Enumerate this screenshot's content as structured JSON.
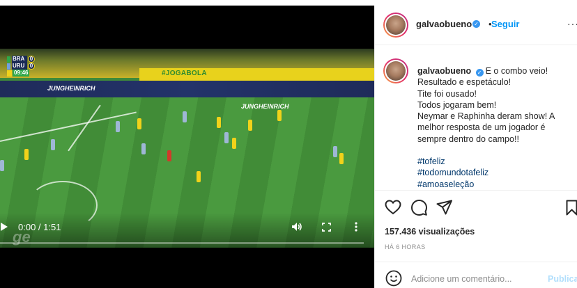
{
  "video": {
    "scoreboard": {
      "home_team": "BRA",
      "home_score": "0",
      "away_team": "URU",
      "away_score": "0",
      "clock": "09:46"
    },
    "banner_text": "#JOGABOLA",
    "ad_text": "JUNGHEINRICH",
    "time_display": "0:00 / 1:51",
    "watermark": "ge"
  },
  "post": {
    "username": "galvaobueno",
    "follow_label": "Seguir",
    "caption_lines": [
      "E o combo veio!",
      "Resultado e espetáculo!",
      "Tite foi ousado!",
      "Todos jogaram bem!",
      "Neymar e Raphinha deram show! A",
      "melhor resposta de um jogador é",
      "sempre dentro do campo!!"
    ],
    "hashtags": [
      "#tofeliz",
      "#todomundotafeliz",
      "#amoaseleção"
    ],
    "views": "157.436 visualizações",
    "time_ago": "HÁ 6 HORAS",
    "comment_placeholder": "Adicione um comentário...",
    "publish_label": "Publicar"
  },
  "colors": {
    "accent": "#0095f6",
    "verified": "#3897f0",
    "hashtag": "#00376b",
    "muted": "#8e8e8e"
  },
  "icons": [
    "heart-icon",
    "comment-icon",
    "share-icon",
    "bookmark-icon",
    "emoji-icon",
    "play-icon",
    "volume-icon",
    "fullscreen-icon",
    "more-options-icon",
    "verified-icon"
  ]
}
